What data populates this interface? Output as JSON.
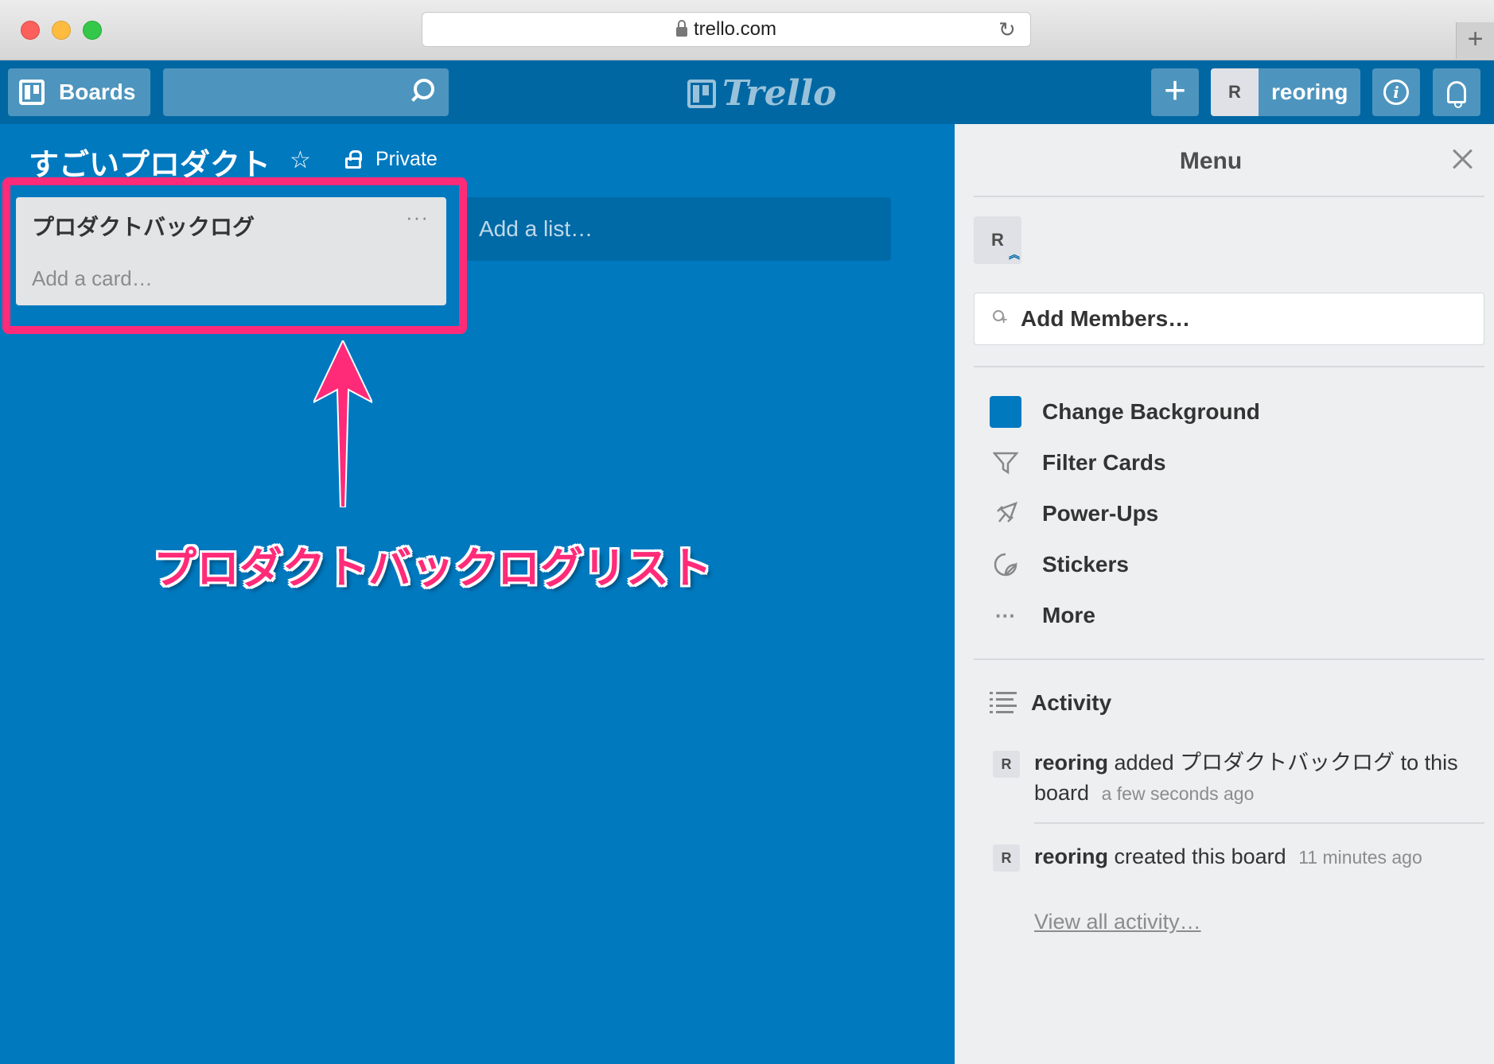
{
  "browser": {
    "url": "trello.com"
  },
  "header": {
    "boards_label": "Boards",
    "logo_text": "Trello",
    "add_label": "+",
    "member_initial": "R",
    "member_name": "reoring",
    "info_label": "i"
  },
  "board": {
    "title": "すごいプロダクト",
    "visibility": "Private",
    "lists": [
      {
        "title": "プロダクトバックログ",
        "menu": "···",
        "add_card": "Add a card…"
      }
    ],
    "add_list": "Add a list…"
  },
  "annotation": {
    "label": "プロダクトバックログリスト",
    "color": "#ff2b78"
  },
  "sidebar": {
    "title": "Menu",
    "member_initial": "R",
    "add_members": "Add Members…",
    "items": [
      {
        "label": "Change Background",
        "icon": "background-swatch"
      },
      {
        "label": "Filter Cards",
        "icon": "filter-icon"
      },
      {
        "label": "Power-Ups",
        "icon": "rocket-icon"
      },
      {
        "label": "Stickers",
        "icon": "sticker-icon"
      },
      {
        "label": "More",
        "icon": "more-icon"
      }
    ],
    "activity": {
      "title": "Activity",
      "entries": [
        {
          "initial": "R",
          "user": "reoring",
          "action": "added プロダクトバックログ to this board",
          "time": "a few seconds ago"
        },
        {
          "initial": "R",
          "user": "reoring",
          "action": "created this board",
          "time": "11 minutes ago"
        }
      ],
      "view_all": "View all activity…"
    }
  },
  "colors": {
    "board_bg": "#0079bf",
    "header_bg": "#0067a3",
    "sidebar_bg": "#edeff0"
  }
}
